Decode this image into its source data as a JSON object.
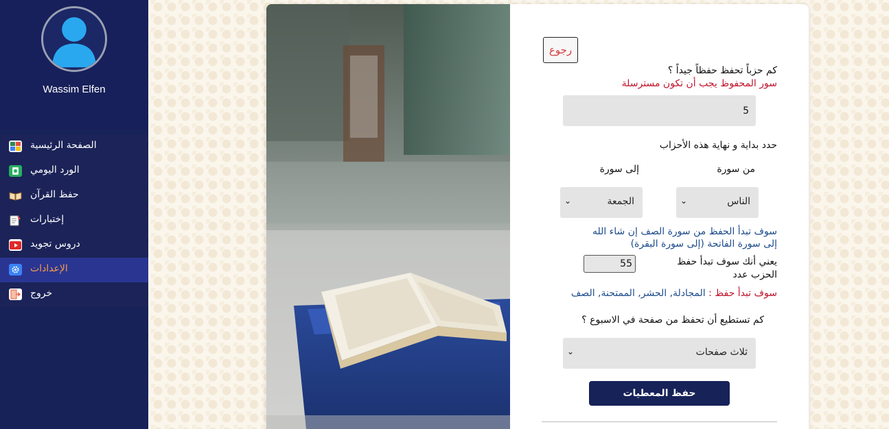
{
  "user": {
    "name": "Wassim Elfen"
  },
  "sidebar": {
    "items": [
      {
        "label": "الصفحة الرئيسية",
        "icon": "home-dashboard-icon",
        "color": "#2e8b57"
      },
      {
        "label": "الورد اليومي",
        "icon": "quran-daily-icon",
        "color": "#27ae60"
      },
      {
        "label": "حفظ القرآن",
        "icon": "open-book-icon",
        "color": "#c8a046"
      },
      {
        "label": "إختبارات",
        "icon": "test-checklist-icon",
        "color": "#e84c3d"
      },
      {
        "label": "دروس تجويد",
        "icon": "video-play-icon",
        "color": "#e02a2a"
      },
      {
        "label": "الإعدادات",
        "icon": "settings-gear-icon",
        "color": "#3b82f6"
      },
      {
        "label": "خروج",
        "icon": "logout-door-icon",
        "color": "#e8634a"
      }
    ],
    "active_index": 5
  },
  "form": {
    "back_label": "رجوع",
    "q_hizb": "كم حزباً تحفظ حفظاً جيداً ؟",
    "q_hizb_note": "سور المحفوظ يجب أن تكون مسترسلة",
    "hizb_count_value": "5",
    "q_range": "حدد بداية و نهاية هذه الأحزاب",
    "from_label": "من سورة",
    "to_label": "إلى سورة",
    "from_selected": "الناس",
    "to_selected": "الجمعة",
    "info_line1": "سوف تبدأ الحفظ من سورة الصف إن شاء الله",
    "info_line2": "إلى سورة الفاتحة (إلى سورة البقرة)",
    "hizb_start_line1": "يعني أنك سوف تبدأ حفظ",
    "hizb_start_line2": "الحزب عدد",
    "hizb_start_value": "55",
    "start_prefix": "سوف تبدأ حفظ :",
    "start_surahs": "المجادلة, الحشر, الممتحنة, الصف",
    "q_pages": "كم تستطيع أن تحفظ من صفحة في الاسبوع ؟",
    "pages_selected": "ثلاث صفحات",
    "save_label": "حفظ المعطيات"
  },
  "colors": {
    "sidebar_bg": "#172259",
    "active_item_bg": "#2a3592",
    "active_item_text": "#f39c4a",
    "note_red": "#c0142b",
    "info_blue": "#1c4b8c",
    "primary_button": "#172259"
  }
}
